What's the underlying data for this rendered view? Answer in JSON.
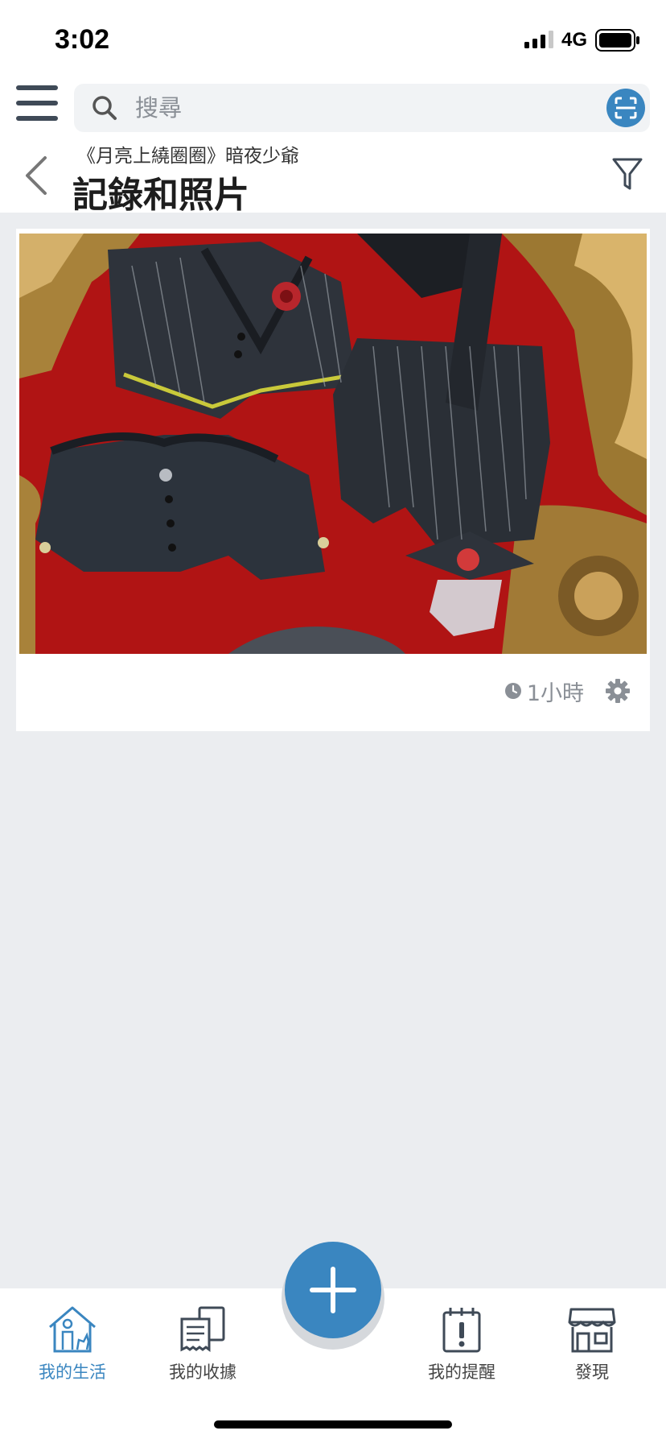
{
  "status_bar": {
    "time": "3:02",
    "network": "4G"
  },
  "search": {
    "placeholder": "搜尋",
    "value": ""
  },
  "header": {
    "breadcrumb": "《月亮上繞圈圈》暗夜少爺",
    "title": "記錄和照片"
  },
  "card": {
    "time_ago": "1小時"
  },
  "bottom_nav": {
    "items": [
      {
        "label": "我的生活",
        "icon": "home-person-icon",
        "active": true
      },
      {
        "label": "我的收據",
        "icon": "receipts-icon",
        "active": false
      },
      {
        "label": "我的提醒",
        "icon": "reminder-icon",
        "active": false
      },
      {
        "label": "發現",
        "icon": "store-icon",
        "active": false
      }
    ]
  },
  "colors": {
    "accent": "#3a86c0",
    "background": "#ebedf0",
    "muted_text": "#8a8f96"
  }
}
